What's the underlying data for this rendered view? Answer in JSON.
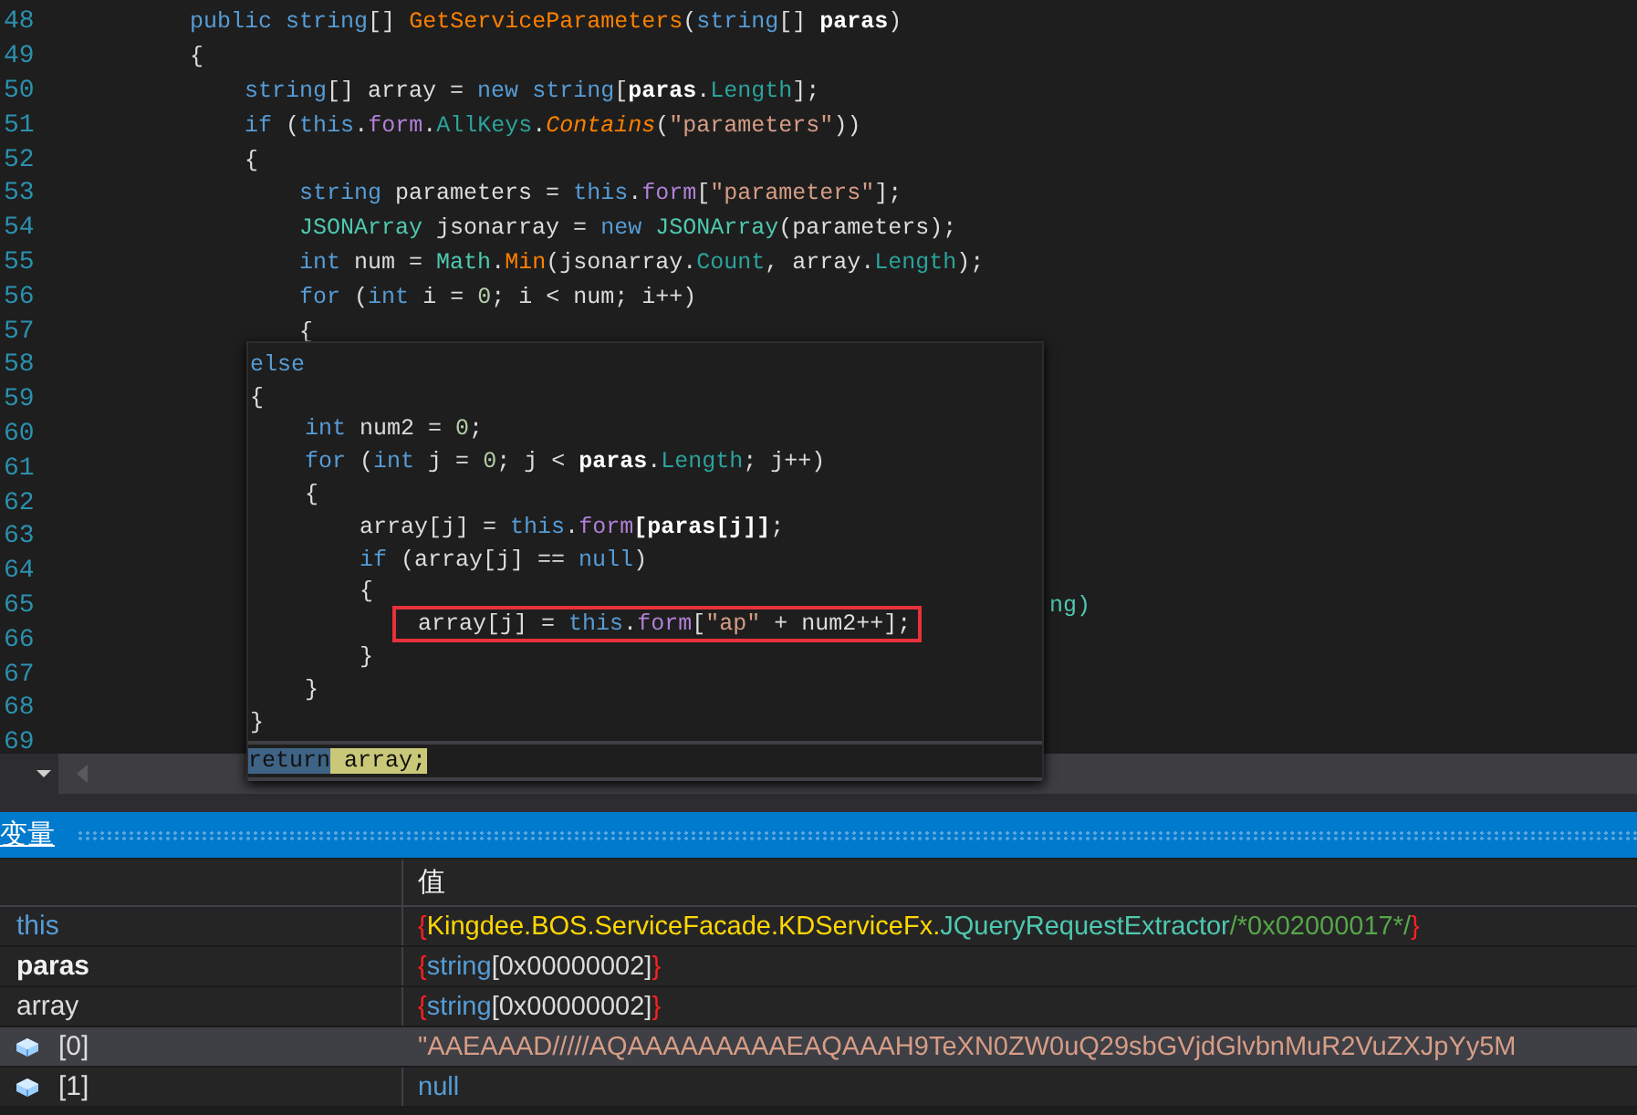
{
  "editor": {
    "lines": [
      {
        "number": "48",
        "tokens": [
          {
            "text": "        public",
            "kind": "kw"
          },
          {
            "text": " string",
            "kind": "kw"
          },
          {
            "text": "[] ",
            "kind": "plain"
          },
          {
            "text": "GetServiceParameters",
            "kind": "method"
          },
          {
            "text": "(",
            "kind": "plain"
          },
          {
            "text": "string",
            "kind": "kw"
          },
          {
            "text": "[] ",
            "kind": "plain"
          },
          {
            "text": "paras",
            "kind": "param"
          },
          {
            "text": ")",
            "kind": "plain"
          }
        ]
      },
      {
        "number": "49",
        "tokens": [
          {
            "text": "        {",
            "kind": "plain"
          }
        ]
      },
      {
        "number": "50",
        "tokens": [
          {
            "text": "            string",
            "kind": "kw"
          },
          {
            "text": "[] array = ",
            "kind": "plain"
          },
          {
            "text": "new",
            "kind": "kw"
          },
          {
            "text": " string",
            "kind": "kw"
          },
          {
            "text": "[",
            "kind": "plain"
          },
          {
            "text": "paras",
            "kind": "param"
          },
          {
            "text": ".",
            "kind": "plain"
          },
          {
            "text": "Length",
            "kind": "prop"
          },
          {
            "text": "];",
            "kind": "plain"
          }
        ]
      },
      {
        "number": "51",
        "tokens": [
          {
            "text": "            if",
            "kind": "kw"
          },
          {
            "text": " (",
            "kind": "plain"
          },
          {
            "text": "this",
            "kind": "kw"
          },
          {
            "text": ".",
            "kind": "plain"
          },
          {
            "text": "form",
            "kind": "field"
          },
          {
            "text": ".",
            "kind": "plain"
          },
          {
            "text": "AllKeys",
            "kind": "prop"
          },
          {
            "text": ".",
            "kind": "plain"
          },
          {
            "text": "Contains",
            "kind": "ext"
          },
          {
            "text": "(",
            "kind": "plain"
          },
          {
            "text": "\"parameters\"",
            "kind": "str"
          },
          {
            "text": "))",
            "kind": "plain"
          }
        ]
      },
      {
        "number": "52",
        "tokens": [
          {
            "text": "            {",
            "kind": "plain"
          }
        ]
      },
      {
        "number": "53",
        "tokens": [
          {
            "text": "                string",
            "kind": "kw"
          },
          {
            "text": " parameters = ",
            "kind": "plain"
          },
          {
            "text": "this",
            "kind": "kw"
          },
          {
            "text": ".",
            "kind": "plain"
          },
          {
            "text": "form",
            "kind": "field"
          },
          {
            "text": "[",
            "kind": "plain"
          },
          {
            "text": "\"parameters\"",
            "kind": "str"
          },
          {
            "text": "];",
            "kind": "plain"
          }
        ]
      },
      {
        "number": "54",
        "tokens": [
          {
            "text": "                JSONArray",
            "kind": "type"
          },
          {
            "text": " jsonarray = ",
            "kind": "plain"
          },
          {
            "text": "new",
            "kind": "kw"
          },
          {
            "text": " JSONArray",
            "kind": "type"
          },
          {
            "text": "(parameters);",
            "kind": "plain"
          }
        ]
      },
      {
        "number": "55",
        "tokens": [
          {
            "text": "                int",
            "kind": "kw"
          },
          {
            "text": " num = ",
            "kind": "plain"
          },
          {
            "text": "Math",
            "kind": "type"
          },
          {
            "text": ".",
            "kind": "plain"
          },
          {
            "text": "Min",
            "kind": "method"
          },
          {
            "text": "(jsonarray.",
            "kind": "plain"
          },
          {
            "text": "Count",
            "kind": "prop"
          },
          {
            "text": ", array.",
            "kind": "plain"
          },
          {
            "text": "Length",
            "kind": "prop"
          },
          {
            "text": ");",
            "kind": "plain"
          }
        ]
      },
      {
        "number": "56",
        "tokens": [
          {
            "text": "                for",
            "kind": "kw"
          },
          {
            "text": " (",
            "kind": "plain"
          },
          {
            "text": "int",
            "kind": "kw"
          },
          {
            "text": " i = ",
            "kind": "plain"
          },
          {
            "text": "0",
            "kind": "num"
          },
          {
            "text": "; i < num; i++)",
            "kind": "plain"
          }
        ]
      },
      {
        "number": "57",
        "tokens": [
          {
            "text": "                {",
            "kind": "plain"
          }
        ]
      },
      {
        "number": "58"
      },
      {
        "number": "59"
      },
      {
        "number": "60"
      },
      {
        "number": "61"
      },
      {
        "number": "62"
      },
      {
        "number": "63"
      },
      {
        "number": "64"
      },
      {
        "number": "65",
        "tail": "ng)"
      },
      {
        "number": "66"
      },
      {
        "number": "67"
      },
      {
        "number": "68"
      },
      {
        "number": "69"
      }
    ]
  },
  "peek": {
    "lines": [
      {
        "boxed": false,
        "tokens": [
          {
            "text": "else",
            "kind": "kw"
          }
        ]
      },
      {
        "boxed": false,
        "tokens": [
          {
            "text": "{",
            "kind": "plain"
          }
        ]
      },
      {
        "boxed": false,
        "tokens": [
          {
            "text": "    int",
            "kind": "kw"
          },
          {
            "text": " num2 = ",
            "kind": "plain"
          },
          {
            "text": "0",
            "kind": "num"
          },
          {
            "text": ";",
            "kind": "plain"
          }
        ]
      },
      {
        "boxed": false,
        "tokens": [
          {
            "text": "    for",
            "kind": "kw"
          },
          {
            "text": " (",
            "kind": "plain"
          },
          {
            "text": "int",
            "kind": "kw"
          },
          {
            "text": " j = ",
            "kind": "plain"
          },
          {
            "text": "0",
            "kind": "num"
          },
          {
            "text": "; j < ",
            "kind": "plain"
          },
          {
            "text": "paras",
            "kind": "param"
          },
          {
            "text": ".",
            "kind": "plain"
          },
          {
            "text": "Length",
            "kind": "prop"
          },
          {
            "text": "; j++)",
            "kind": "plain"
          }
        ]
      },
      {
        "boxed": false,
        "tokens": [
          {
            "text": "    {",
            "kind": "plain"
          }
        ]
      },
      {
        "boxed": false,
        "tokens": [
          {
            "text": "        array[j] = ",
            "kind": "plain"
          },
          {
            "text": "this",
            "kind": "kw"
          },
          {
            "text": ".",
            "kind": "plain"
          },
          {
            "text": "form",
            "kind": "field"
          },
          {
            "text": "[paras[j]]",
            "kind": "param"
          },
          {
            "text": ";",
            "kind": "plain"
          }
        ]
      },
      {
        "boxed": false,
        "tokens": [
          {
            "text": "        if",
            "kind": "kw"
          },
          {
            "text": " (array[j] == ",
            "kind": "plain"
          },
          {
            "text": "null",
            "kind": "kw"
          },
          {
            "text": ")",
            "kind": "plain"
          }
        ]
      },
      {
        "boxed": false,
        "tokens": [
          {
            "text": "        {",
            "kind": "plain"
          }
        ]
      },
      {
        "boxed": true,
        "tokens": [
          {
            "text": "            array[j] = ",
            "kind": "plain"
          },
          {
            "text": "this",
            "kind": "kw"
          },
          {
            "text": ".",
            "kind": "plain"
          },
          {
            "text": "form",
            "kind": "field"
          },
          {
            "text": "[",
            "kind": "plain"
          },
          {
            "text": "\"ap\"",
            "kind": "str"
          },
          {
            "text": " + num2++];",
            "kind": "plain"
          }
        ]
      },
      {
        "boxed": false,
        "tokens": [
          {
            "text": "        }",
            "kind": "plain"
          }
        ]
      },
      {
        "boxed": false,
        "tokens": [
          {
            "text": "    }",
            "kind": "plain"
          }
        ]
      },
      {
        "boxed": false,
        "tokens": [
          {
            "text": "}",
            "kind": "plain"
          }
        ]
      }
    ],
    "footer_tokens": [
      {
        "text": "return",
        "kind": "hl-blue"
      },
      {
        "text": " array;",
        "kind": "hl-yellow"
      }
    ]
  },
  "panel": {
    "title": "变量",
    "columns": {
      "column_2": "值"
    },
    "rows": [
      {
        "name": "this",
        "bold": false,
        "selected": false,
        "value": [
          {
            "text": "{",
            "kind": "brace"
          },
          {
            "text": "Kingdee.BOS.ServiceFacade.KDServiceFx.",
            "kind": "ns"
          },
          {
            "text": "JQueryRequestExtractor",
            "kind": "cls"
          },
          {
            "text": "/*0x02000017*/",
            "kind": "comment"
          },
          {
            "text": "}",
            "kind": "brace"
          }
        ]
      },
      {
        "name": "paras",
        "bold": true,
        "selected": false,
        "value": [
          {
            "text": "{",
            "kind": "brace"
          },
          {
            "text": "string",
            "kind": "kw"
          },
          {
            "text": "[0x00000002]",
            "kind": "plain"
          },
          {
            "text": "}",
            "kind": "brace"
          }
        ]
      },
      {
        "name": "array",
        "bold": false,
        "selected": false,
        "value": [
          {
            "text": "{",
            "kind": "brace"
          },
          {
            "text": "string",
            "kind": "kw"
          },
          {
            "text": "[0x00000002]",
            "kind": "plain"
          },
          {
            "text": "}",
            "kind": "brace"
          }
        ],
        "children": [
          {
            "name": "[0]",
            "bold": false,
            "selected": true,
            "value": [
              {
                "text": "\"AAEAAAD/////AQAAAAAAAAAEAQAAAH9TeXN0ZW0uQ29sbGVjdGlvbnMuR2VuZXJpYy5M",
                "kind": "str"
              }
            ]
          },
          {
            "name": "[1]",
            "bold": false,
            "selected": false,
            "value": [
              {
                "text": "null",
                "kind": "kw"
              }
            ]
          }
        ]
      }
    ]
  }
}
